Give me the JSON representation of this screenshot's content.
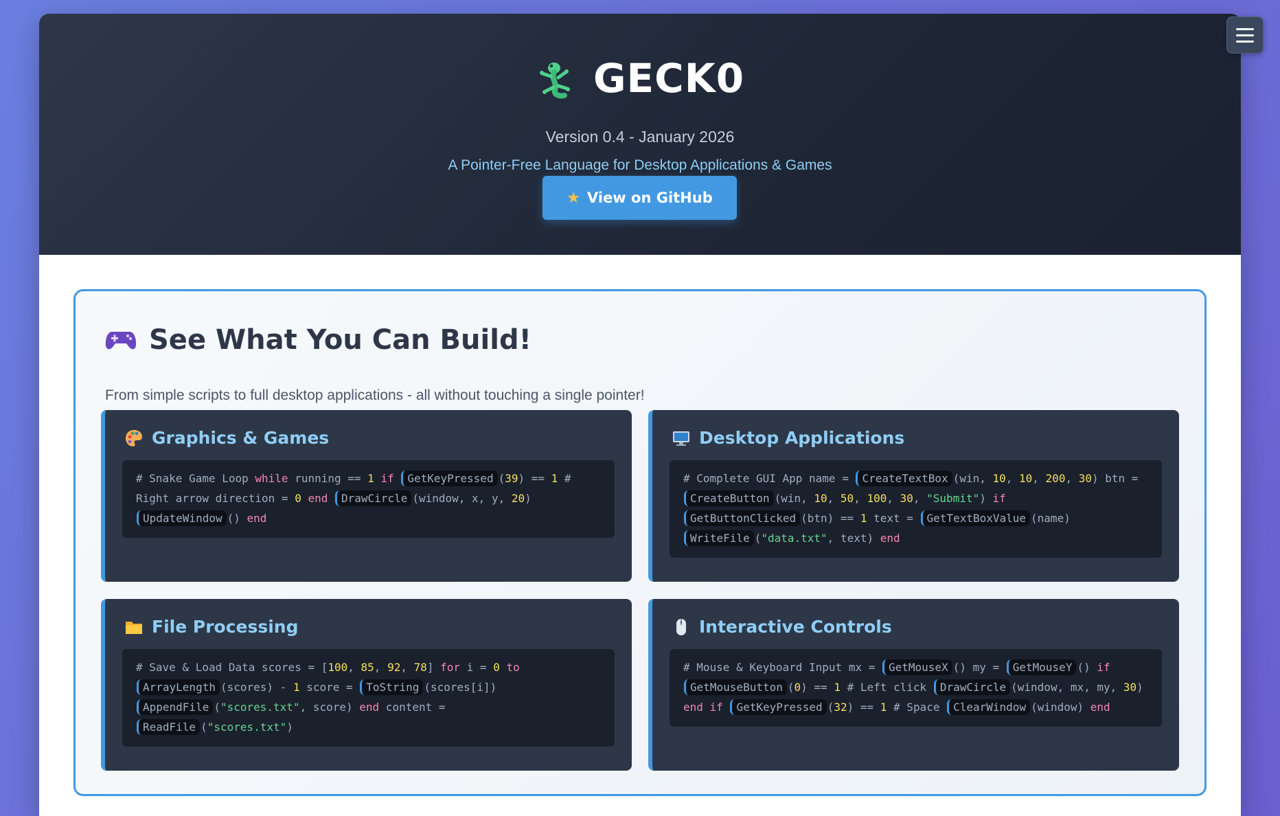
{
  "header": {
    "title": "GECK0",
    "version": "Version 0.4 - January 2026",
    "tagline": "A Pointer-Free Language for Desktop Applications & Games",
    "github_button": "View on GitHub",
    "logo_icon": "gecko-icon",
    "menu_icon": "hamburger-menu-icon"
  },
  "showcase": {
    "title": "See What You Can Build!",
    "subtitle": "From simple scripts to full desktop applications - all without touching a single pointer!",
    "cards": [
      {
        "title": "Graphics & Games",
        "icon": "palette-icon",
        "code": [
          {
            "t": "# Snake Game Loop "
          },
          {
            "t": "while",
            "c": "k"
          },
          {
            "t": " running == "
          },
          {
            "t": "1",
            "c": "n"
          },
          {
            "t": " "
          },
          {
            "t": "if",
            "c": "k"
          },
          {
            "t": " "
          },
          {
            "t": "GetKeyPressed",
            "c": "fn"
          },
          {
            "t": "("
          },
          {
            "t": "39",
            "c": "n"
          },
          {
            "t": ") == "
          },
          {
            "t": "1",
            "c": "n"
          },
          {
            "t": " # Right arrow direction = "
          },
          {
            "t": "0",
            "c": "n"
          },
          {
            "t": " "
          },
          {
            "t": "end",
            "c": "k"
          },
          {
            "t": " "
          },
          {
            "t": "DrawCircle",
            "c": "fn"
          },
          {
            "t": "(window, x, y, "
          },
          {
            "t": "20",
            "c": "n"
          },
          {
            "t": ") "
          },
          {
            "t": "UpdateWindow",
            "c": "fn"
          },
          {
            "t": "() "
          },
          {
            "t": "end",
            "c": "k"
          }
        ]
      },
      {
        "title": "Desktop Applications",
        "icon": "desktop-computer-icon",
        "code": [
          {
            "t": "# Complete GUI App name = "
          },
          {
            "t": "CreateTextBox",
            "c": "fn"
          },
          {
            "t": "(win, "
          },
          {
            "t": "10",
            "c": "n"
          },
          {
            "t": ", "
          },
          {
            "t": "10",
            "c": "n"
          },
          {
            "t": ", "
          },
          {
            "t": "200",
            "c": "n"
          },
          {
            "t": ", "
          },
          {
            "t": "30",
            "c": "n"
          },
          {
            "t": ") btn = "
          },
          {
            "t": "CreateButton",
            "c": "fn"
          },
          {
            "t": "(win, "
          },
          {
            "t": "10",
            "c": "n"
          },
          {
            "t": ", "
          },
          {
            "t": "50",
            "c": "n"
          },
          {
            "t": ", "
          },
          {
            "t": "100",
            "c": "n"
          },
          {
            "t": ", "
          },
          {
            "t": "30",
            "c": "n"
          },
          {
            "t": ", "
          },
          {
            "t": "\"Submit\"",
            "c": "s"
          },
          {
            "t": ") "
          },
          {
            "t": "if",
            "c": "k"
          },
          {
            "t": " "
          },
          {
            "t": "GetButtonClicked",
            "c": "fn"
          },
          {
            "t": "(btn) == "
          },
          {
            "t": "1",
            "c": "n"
          },
          {
            "t": " text = "
          },
          {
            "t": "GetTextBoxValue",
            "c": "fn"
          },
          {
            "t": "(name) "
          },
          {
            "t": "WriteFile",
            "c": "fn"
          },
          {
            "t": "("
          },
          {
            "t": "\"data.txt\"",
            "c": "s"
          },
          {
            "t": ", text) "
          },
          {
            "t": "end",
            "c": "k"
          }
        ]
      },
      {
        "title": "File Processing",
        "icon": "folder-icon",
        "code": [
          {
            "t": "# Save & Load Data scores = ["
          },
          {
            "t": "100",
            "c": "n"
          },
          {
            "t": ", "
          },
          {
            "t": "85",
            "c": "n"
          },
          {
            "t": ", "
          },
          {
            "t": "92",
            "c": "n"
          },
          {
            "t": ", "
          },
          {
            "t": "78",
            "c": "n"
          },
          {
            "t": "] "
          },
          {
            "t": "for",
            "c": "k"
          },
          {
            "t": " i = "
          },
          {
            "t": "0",
            "c": "n"
          },
          {
            "t": " "
          },
          {
            "t": "to",
            "c": "k"
          },
          {
            "t": " "
          },
          {
            "t": "ArrayLength",
            "c": "fn"
          },
          {
            "t": "(scores) - "
          },
          {
            "t": "1",
            "c": "n"
          },
          {
            "t": " score = "
          },
          {
            "t": "ToString",
            "c": "fn"
          },
          {
            "t": "(scores[i]) "
          },
          {
            "t": "AppendFile",
            "c": "fn"
          },
          {
            "t": "("
          },
          {
            "t": "\"scores.txt\"",
            "c": "s"
          },
          {
            "t": ", score) "
          },
          {
            "t": "end",
            "c": "k"
          },
          {
            "t": " content = "
          },
          {
            "t": "ReadFile",
            "c": "fn"
          },
          {
            "t": "("
          },
          {
            "t": "\"scores.txt\"",
            "c": "s"
          },
          {
            "t": ")"
          }
        ]
      },
      {
        "title": "Interactive Controls",
        "icon": "mouse-icon",
        "code": [
          {
            "t": "# Mouse & Keyboard Input mx = "
          },
          {
            "t": "GetMouseX",
            "c": "fn"
          },
          {
            "t": "() my = "
          },
          {
            "t": "GetMouseY",
            "c": "fn"
          },
          {
            "t": "() "
          },
          {
            "t": "if",
            "c": "k"
          },
          {
            "t": " "
          },
          {
            "t": "GetMouseButton",
            "c": "fn"
          },
          {
            "t": "("
          },
          {
            "t": "0",
            "c": "n"
          },
          {
            "t": ") == "
          },
          {
            "t": "1",
            "c": "n"
          },
          {
            "t": " # Left click "
          },
          {
            "t": "DrawCircle",
            "c": "fn"
          },
          {
            "t": "(window, mx, my, "
          },
          {
            "t": "30",
            "c": "n"
          },
          {
            "t": ") "
          },
          {
            "t": "end",
            "c": "k"
          },
          {
            "t": " "
          },
          {
            "t": "if",
            "c": "k"
          },
          {
            "t": " "
          },
          {
            "t": "GetKeyPressed",
            "c": "fn"
          },
          {
            "t": "("
          },
          {
            "t": "32",
            "c": "n"
          },
          {
            "t": ") == "
          },
          {
            "t": "1",
            "c": "n"
          },
          {
            "t": " # Space "
          },
          {
            "t": "ClearWindow",
            "c": "fn"
          },
          {
            "t": "(window) "
          },
          {
            "t": "end",
            "c": "k"
          }
        ]
      }
    ]
  },
  "colors": {
    "accent": "#4299e1",
    "hero_bg": "#2d3748",
    "keyword": "#f687b3",
    "number": "#f6e05e",
    "string": "#68d391"
  }
}
